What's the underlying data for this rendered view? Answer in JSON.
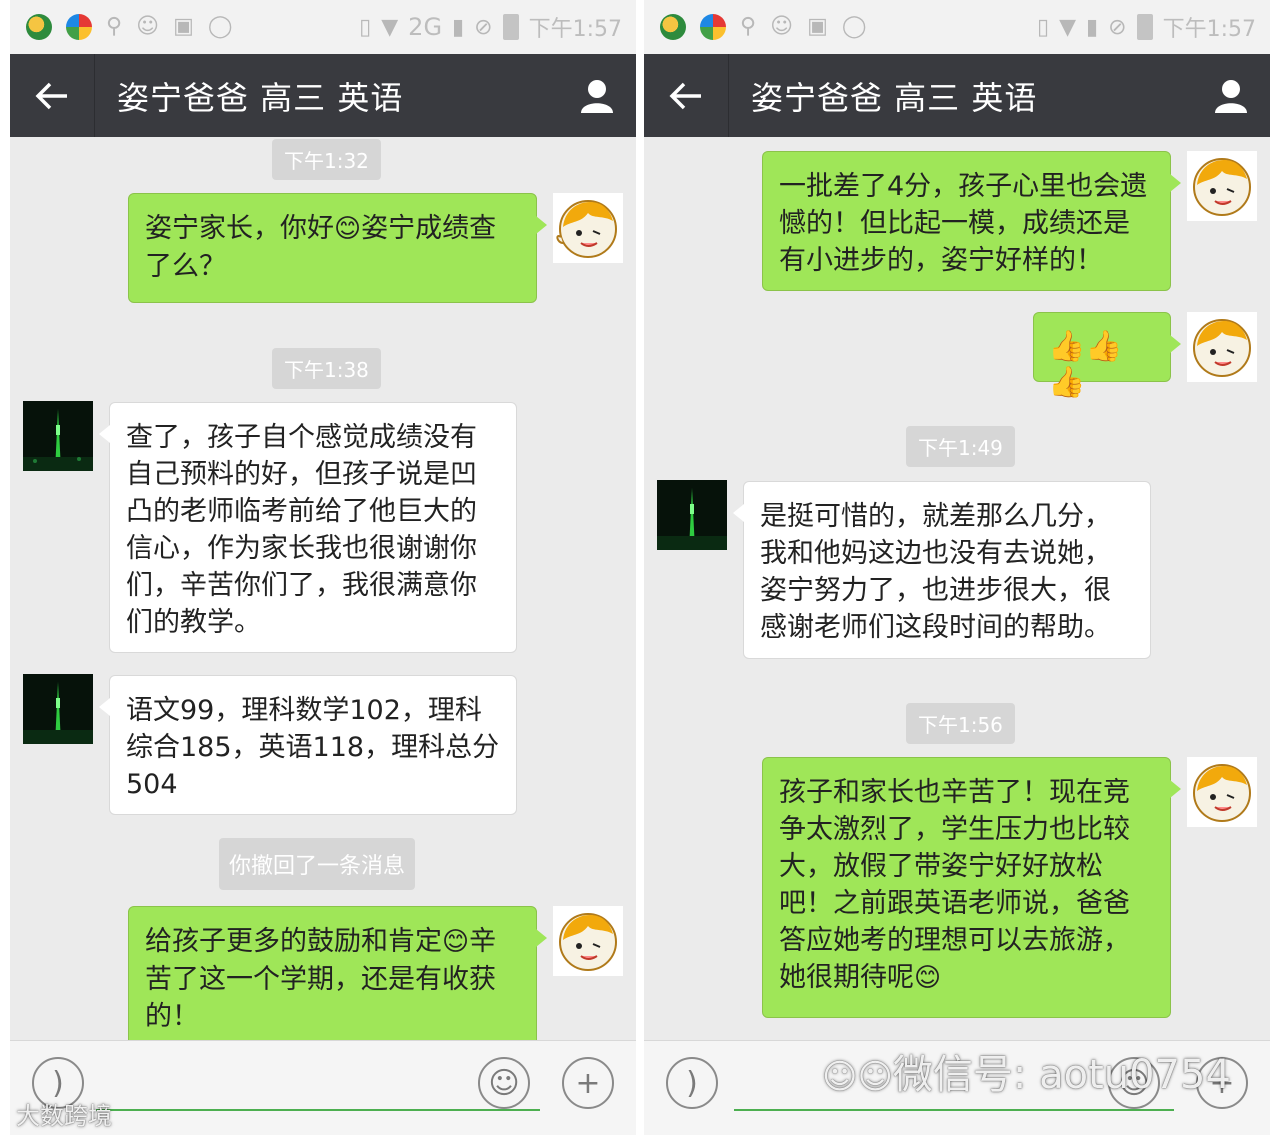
{
  "status_bar": {
    "network": "2G",
    "time": "下午1:57"
  },
  "chat": {
    "title": "姿宁爸爸 高三 英语"
  },
  "left": {
    "timestamps": [
      "下午1:32",
      "下午1:38"
    ],
    "messages": [
      {
        "side": "out",
        "text_a": "姿宁家长，你好",
        "emoji": "😊",
        "text_b": "姿宁成绩查了么？"
      },
      {
        "side": "in",
        "text": "查了，孩子自个感觉成绩没有自己预料的好，但孩子说是凹凸的老师临考前给了他巨大的信心，作为家长我也很谢谢你们，辛苦你们了，我很满意你们的教学。"
      },
      {
        "side": "in",
        "text": "语文99，理科数学102，理科综合185，英语118，理科总分504"
      },
      {
        "side": "out",
        "text_a": "给孩子更多的鼓励和肯定",
        "emoji": "😊",
        "text_b": "辛苦了这一个学期，还是有收获的！"
      }
    ],
    "recall_notice": "你撤回了一条消息"
  },
  "right": {
    "timestamps": [
      "下午1:49",
      "下午1:56"
    ],
    "messages": [
      {
        "side": "out",
        "text": "一批差了4分，孩子心里也会遗憾的！但比起一模，成绩还是有小进步的，姿宁好样的！"
      },
      {
        "side": "out",
        "emoji": "👍👍👍"
      },
      {
        "side": "in",
        "text": "是挺可惜的，就差那么几分，我和他妈这边也没有去说她，姿宁努力了，也进步很大，很感谢老师们这段时间的帮助。"
      },
      {
        "side": "out",
        "text_a": "孩子和家长也辛苦了！现在竞争太激烈了，学生压力也比较大，放假了带姿宁好好放松吧！之前跟英语老师说，爸爸答应她考的理想可以去旅游，她很期待呢",
        "emoji": "😊"
      }
    ]
  },
  "watermarks": {
    "left": "大数跨境",
    "right": "微信号: aotu0754"
  },
  "colors": {
    "titlebar": "#393a3f",
    "outgoing_bubble": "#9fe658",
    "incoming_bubble": "#ffffff",
    "chat_bg": "#ebebeb"
  }
}
